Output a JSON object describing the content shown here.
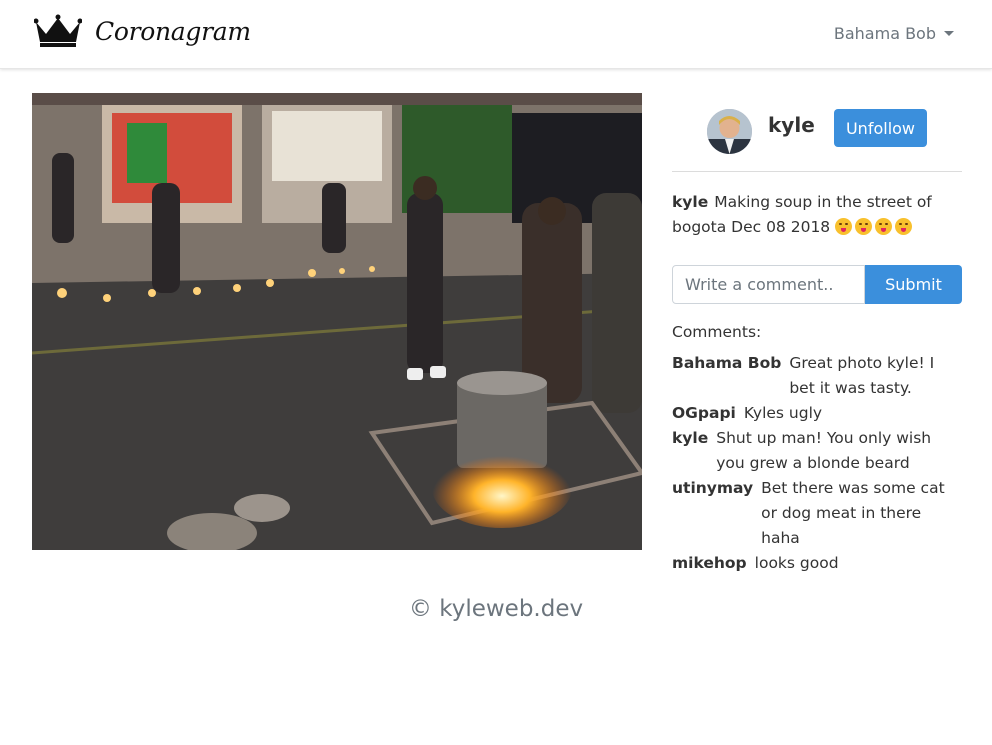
{
  "navbar": {
    "brand": "Coronagram",
    "brand_icon": "crown-icon",
    "user_menu": "Bahama Bob"
  },
  "post": {
    "image_alt": "Making soup in the street of bogota",
    "author": "kyle",
    "follow_button": "Unfollow",
    "caption_author": "kyle",
    "caption_text": "Making soup in the street of bogota Dec 08 2018",
    "caption_emoji_count": 4
  },
  "comment_form": {
    "placeholder": "Write a comment..",
    "submit_label": "Submit"
  },
  "comments_label": "Comments:",
  "comments": [
    {
      "user": "Bahama Bob",
      "text": "Great photo kyle! I bet it was tasty."
    },
    {
      "user": "OGpapi",
      "text": "Kyles ugly"
    },
    {
      "user": "kyle",
      "text": "Shut up man! You only wish you grew a blonde beard"
    },
    {
      "user": "utinymay",
      "text": "Bet there was some cat or dog meat in there haha"
    },
    {
      "user": "mikehop",
      "text": "looks good"
    }
  ],
  "footer": "© kyleweb.dev",
  "colors": {
    "primary": "#3b8fdc",
    "muted": "#6c757d"
  }
}
